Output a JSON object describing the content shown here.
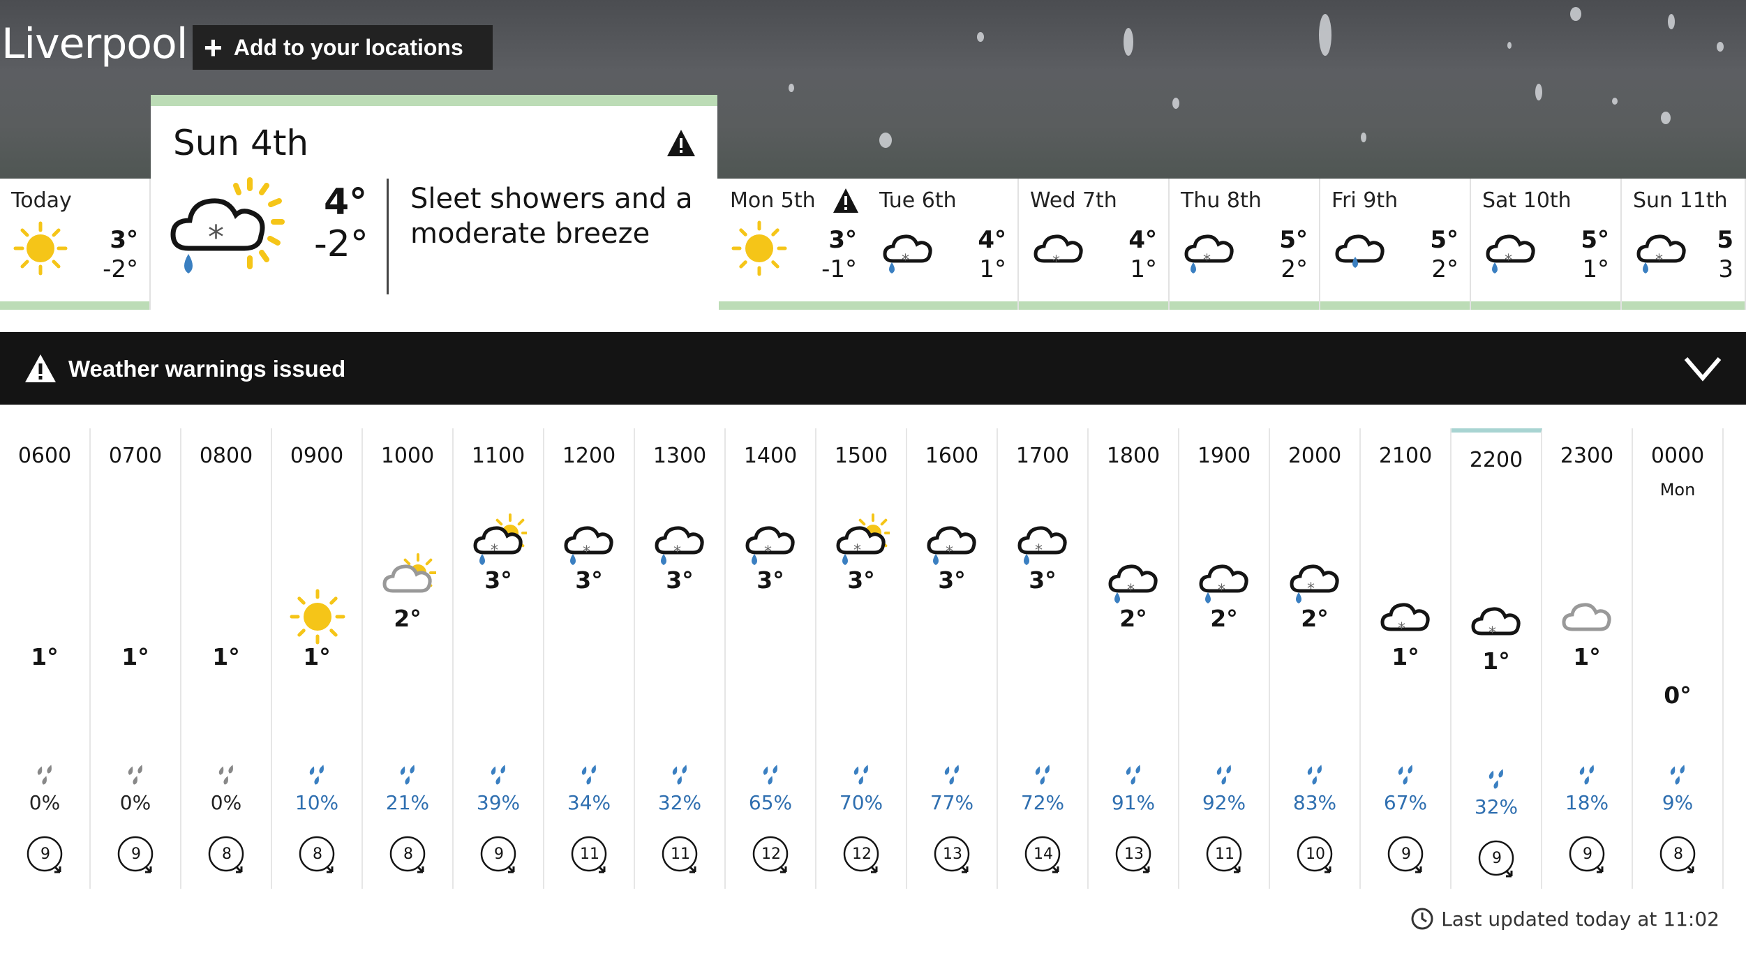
{
  "location": "Liverpool",
  "add_location_label": "Add to your locations",
  "days": [
    {
      "label": "Today",
      "high": "3°",
      "low": "-2°",
      "icon": "sunny-icon",
      "warning": false
    },
    {
      "label": "Sun 4th",
      "high": "4°",
      "low": "-2°",
      "icon": "sleet-showers-sunny-icon",
      "warning": true,
      "selected": true,
      "description": "Sleet showers and a moderate breeze"
    },
    {
      "label": "Mon 5th",
      "high": "3°",
      "low": "-1°",
      "icon": "sunny-icon",
      "warning": true
    },
    {
      "label": "Tue 6th",
      "high": "4°",
      "low": "1°",
      "icon": "sleet-icon",
      "warning": false
    },
    {
      "label": "Wed 7th",
      "high": "4°",
      "low": "1°",
      "icon": "snow-cloud-icon",
      "warning": false
    },
    {
      "label": "Thu 8th",
      "high": "5°",
      "low": "2°",
      "icon": "sleet-icon",
      "warning": false
    },
    {
      "label": "Fri 9th",
      "high": "5°",
      "low": "2°",
      "icon": "rain-icon",
      "warning": false
    },
    {
      "label": "Sat 10th",
      "high": "5°",
      "low": "1°",
      "icon": "sleet-icon",
      "warning": false
    },
    {
      "label": "Sun 11th",
      "high": "5",
      "low": "3",
      "icon": "sleet-icon",
      "warning": false
    }
  ],
  "warnings_label": "Weather warnings issued",
  "hours": [
    {
      "time": "0600",
      "temp": "1°",
      "rain": "0%",
      "wind": "9",
      "icon": "moon-icon"
    },
    {
      "time": "0700",
      "temp": "1°",
      "rain": "0%",
      "wind": "9",
      "icon": "moon-icon"
    },
    {
      "time": "0800",
      "temp": "1°",
      "rain": "0%",
      "wind": "8",
      "icon": "moon-icon"
    },
    {
      "time": "0900",
      "temp": "1°",
      "rain": "10%",
      "wind": "8",
      "icon": "sun-icon"
    },
    {
      "time": "1000",
      "temp": "2°",
      "rain": "21%",
      "wind": "8",
      "icon": "cloud-sun-icon"
    },
    {
      "time": "1100",
      "temp": "3°",
      "rain": "39%",
      "wind": "9",
      "icon": "sleet-sun-icon"
    },
    {
      "time": "1200",
      "temp": "3°",
      "rain": "34%",
      "wind": "11",
      "icon": "sleet-icon"
    },
    {
      "time": "1300",
      "temp": "3°",
      "rain": "32%",
      "wind": "11",
      "icon": "sleet-icon"
    },
    {
      "time": "1400",
      "temp": "3°",
      "rain": "65%",
      "wind": "12",
      "icon": "sleet-icon"
    },
    {
      "time": "1500",
      "temp": "3°",
      "rain": "70%",
      "wind": "12",
      "icon": "sleet-sun-icon"
    },
    {
      "time": "1600",
      "temp": "3°",
      "rain": "77%",
      "wind": "13",
      "icon": "sleet-icon"
    },
    {
      "time": "1700",
      "temp": "3°",
      "rain": "72%",
      "wind": "14",
      "icon": "sleet-moon-icon"
    },
    {
      "time": "1800",
      "temp": "2°",
      "rain": "91%",
      "wind": "13",
      "icon": "sleet-icon"
    },
    {
      "time": "1900",
      "temp": "2°",
      "rain": "92%",
      "wind": "11",
      "icon": "sleet-icon"
    },
    {
      "time": "2000",
      "temp": "2°",
      "rain": "83%",
      "wind": "10",
      "icon": "sleet-moon-icon"
    },
    {
      "time": "2100",
      "temp": "1°",
      "rain": "67%",
      "wind": "9",
      "icon": "snow-moon-icon"
    },
    {
      "time": "2200",
      "temp": "1°",
      "rain": "32%",
      "wind": "9",
      "icon": "snow-moon-icon"
    },
    {
      "time": "2300",
      "temp": "1°",
      "rain": "18%",
      "wind": "9",
      "icon": "cloud-moon-icon"
    },
    {
      "time": "0000",
      "day": "Mon",
      "temp": "0°",
      "rain": "9%",
      "wind": "8",
      "icon": "moon-icon"
    }
  ],
  "last_updated": "Last updated today at 11:02",
  "colors": {
    "sun": "#f5c518",
    "rain": "#3a7fc1",
    "rain_text": "#2f6fb0",
    "bar": "#bcdcb6",
    "warning_bar": "#141414"
  }
}
